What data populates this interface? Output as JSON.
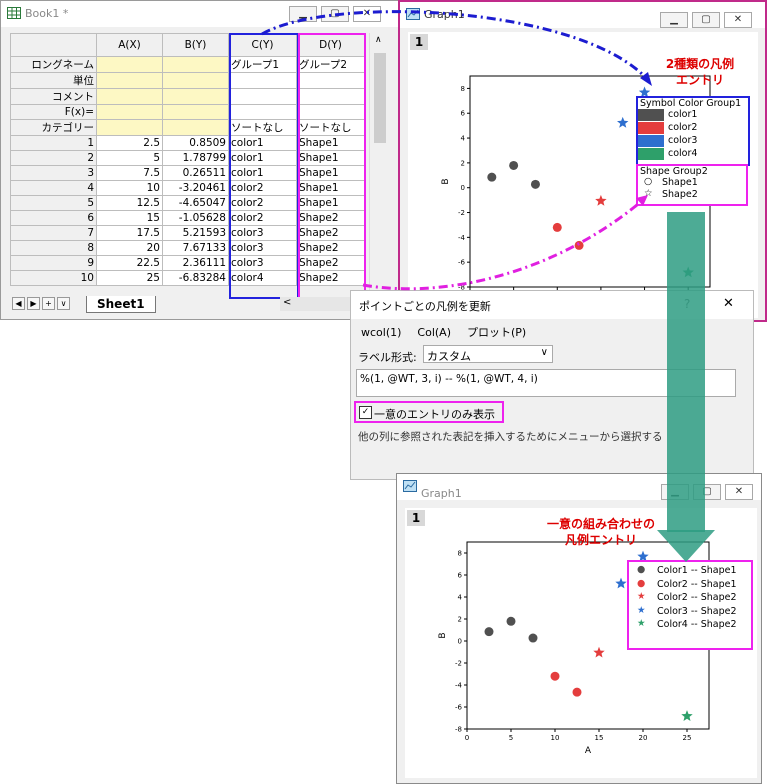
{
  "book": {
    "title": "Book1 *",
    "columns": [
      "A(X)",
      "B(Y)",
      "C(Y)",
      "D(Y)"
    ],
    "meta_rows": [
      {
        "label": "ロングネーム",
        "values": [
          "",
          "",
          "グループ1",
          "グループ2"
        ]
      },
      {
        "label": "単位",
        "values": [
          "",
          "",
          "",
          ""
        ]
      },
      {
        "label": "コメント",
        "values": [
          "",
          "",
          "",
          ""
        ]
      },
      {
        "label": "F(x)=",
        "values": [
          "",
          "",
          "",
          ""
        ]
      },
      {
        "label": "カテゴリー",
        "values": [
          "",
          "",
          "ソートなし",
          "ソートなし"
        ]
      }
    ],
    "rows": [
      [
        "1",
        "2.5",
        "0.8509",
        "color1",
        "Shape1"
      ],
      [
        "2",
        "5",
        "1.78799",
        "color1",
        "Shape1"
      ],
      [
        "3",
        "7.5",
        "0.26511",
        "color1",
        "Shape1"
      ],
      [
        "4",
        "10",
        "-3.20461",
        "color2",
        "Shape1"
      ],
      [
        "5",
        "12.5",
        "-4.65047",
        "color2",
        "Shape1"
      ],
      [
        "6",
        "15",
        "-1.05628",
        "color2",
        "Shape2"
      ],
      [
        "7",
        "17.5",
        "5.21593",
        "color3",
        "Shape2"
      ],
      [
        "8",
        "20",
        "7.67133",
        "color3",
        "Shape2"
      ],
      [
        "9",
        "22.5",
        "2.36111",
        "color3",
        "Shape2"
      ],
      [
        "10",
        "25",
        "-6.83284",
        "color4",
        "Shape2"
      ]
    ],
    "sheet_tab": "Sheet1",
    "nav_buttons": [
      "◀",
      "▶",
      "+",
      "∨"
    ]
  },
  "graph1": {
    "title": "Graph1",
    "layer": "1",
    "annotation": [
      "2種類の凡例",
      "エントリ"
    ],
    "legend_color": {
      "header": "Symbol Color  Group1",
      "items": [
        {
          "label": "color1",
          "color": "#505050"
        },
        {
          "label": "color2",
          "color": "#e43d3d"
        },
        {
          "label": "color3",
          "color": "#2e6fcf"
        },
        {
          "label": "color4",
          "color": "#2ea06a"
        }
      ]
    },
    "legend_shape": {
      "header": "Shape  Group2",
      "items": [
        {
          "label": "Shape1",
          "symbol": "○"
        },
        {
          "label": "Shape2",
          "symbol": "☆"
        }
      ]
    }
  },
  "dialog": {
    "title": "ポイントごとの凡例を更新",
    "help": "?",
    "close": "✕",
    "menus": [
      "wcol(1)",
      "Col(A)",
      "プロット(P)"
    ],
    "label_format_label": "ラベル形式:",
    "label_format_value": "カスタム",
    "expression": "%(1, @WT, 3, i) -- %(1, @WT, 4, i)",
    "checkbox_label": "一意のエントリのみ表示",
    "hint": "他の列に参照された表記を挿入するためにメニューから選択する"
  },
  "graph2": {
    "title": "Graph1",
    "layer": "1",
    "annotation": [
      "一意の組み合わせの",
      "凡例エントリ"
    ],
    "legend": [
      {
        "label": "Color1 -- Shape1",
        "symbol": "●",
        "color": "#505050"
      },
      {
        "label": "Color2 -- Shape1",
        "symbol": "●",
        "color": "#e43d3d"
      },
      {
        "label": "Color2 -- Shape2",
        "symbol": "★",
        "color": "#e43d3d"
      },
      {
        "label": "Color3 -- Shape2",
        "symbol": "★",
        "color": "#2e6fcf"
      },
      {
        "label": "Color4 -- Shape2",
        "symbol": "★",
        "color": "#2ea06a"
      }
    ]
  },
  "chart_data": {
    "type": "scatter",
    "xlabel": "A",
    "ylabel": "B",
    "xlim": [
      0,
      27.5
    ],
    "ylim": [
      -8,
      9
    ],
    "xticks": [
      "0",
      "5",
      "10",
      "15",
      "20",
      "25"
    ],
    "yticks": [
      "-8",
      "-6",
      "-4",
      "-2",
      "0",
      "2",
      "4",
      "6",
      "8"
    ],
    "points": [
      {
        "x": 2.5,
        "y": 0.85,
        "color": "#505050",
        "symbol": "circle"
      },
      {
        "x": 5,
        "y": 1.79,
        "color": "#505050",
        "symbol": "circle"
      },
      {
        "x": 7.5,
        "y": 0.27,
        "color": "#505050",
        "symbol": "circle"
      },
      {
        "x": 10,
        "y": -3.2,
        "color": "#e43d3d",
        "symbol": "circle"
      },
      {
        "x": 12.5,
        "y": -4.65,
        "color": "#e43d3d",
        "symbol": "circle"
      },
      {
        "x": 15,
        "y": -1.06,
        "color": "#e43d3d",
        "symbol": "star"
      },
      {
        "x": 17.5,
        "y": 5.22,
        "color": "#2e6fcf",
        "symbol": "star"
      },
      {
        "x": 20,
        "y": 7.67,
        "color": "#2e6fcf",
        "symbol": "star"
      },
      {
        "x": 22.5,
        "y": 2.36,
        "color": "#2e6fcf",
        "symbol": "star"
      },
      {
        "x": 25,
        "y": -6.83,
        "color": "#2ea06a",
        "symbol": "star"
      }
    ]
  }
}
